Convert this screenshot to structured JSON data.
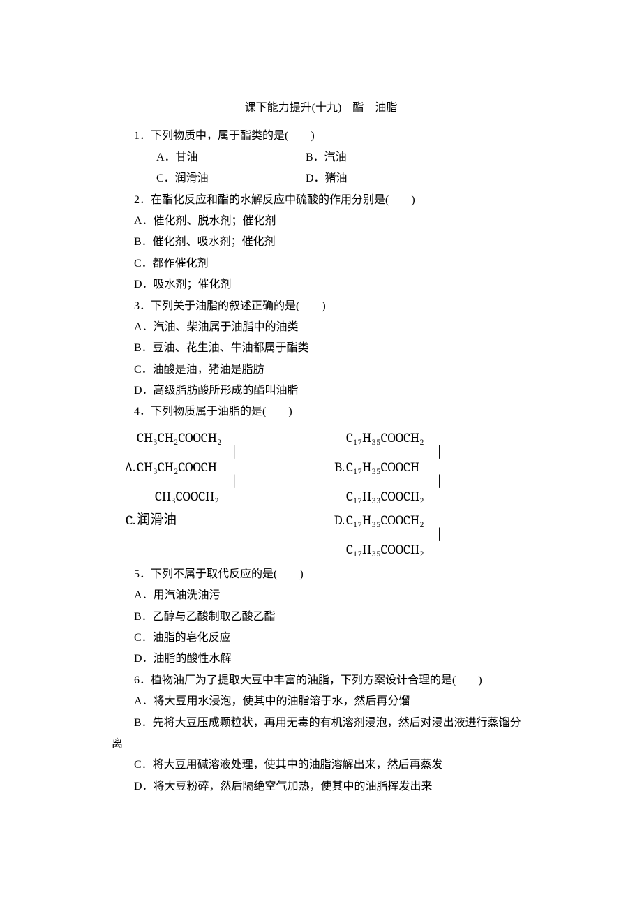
{
  "title": "课下能力提升(十九)　酯　油脂",
  "q1": {
    "stem": "1．下列物质中，属于酯类的是(　　)",
    "a": "A．甘油",
    "b": "B．汽油",
    "c": "C．润滑油",
    "d": "D．猪油"
  },
  "q2": {
    "stem": "2．在酯化反应和酯的水解反应中硫酸的作用分别是(　　)",
    "a": "A．催化剂、脱水剂；催化剂",
    "b": "B．催化剂、吸水剂；催化剂",
    "c": "C．都作催化剂",
    "d": "D．吸水剂；催化剂"
  },
  "q3": {
    "stem": "3．下列关于油脂的叙述正确的是(　　)",
    "a": "A．汽油、柴油属于油脂中的油类",
    "b": "B．豆油、花生油、牛油都属于酯类",
    "c": "C．油酸是油，猪油是脂肪",
    "d": "D．高级脂肪酸所形成的酯叫油脂"
  },
  "q4": {
    "stem": "4．下列物质属于油脂的是(　　)",
    "optA_prefix": "A.",
    "optA_l1": "CH₃CH₂COOCH₂",
    "optA_l2": "CH₃CH₂COOCH",
    "optA_l3": "CH₃COOCH₂",
    "optB_prefix": "B.",
    "optB_l1": "C₁₇H₃₅COOCH₂",
    "optB_l2": "C₁₇H₃₅COOCH",
    "optB_l3": "C₁₇H₃₃COOCH₂",
    "optC_prefix": "C.",
    "optC_text": "润滑油",
    "optD_prefix": "D.",
    "optD_l1": "C₁₇H₃₅COOCH₂",
    "optD_l2": "C₁₇H₃₅COOCH₂"
  },
  "q5": {
    "stem": "5．下列不属于取代反应的是(　　)",
    "a": "A．用汽油洗油污",
    "b": "B．乙醇与乙酸制取乙酸乙酯",
    "c": "C．油脂的皂化反应",
    "d": "D．油脂的酸性水解"
  },
  "q6": {
    "stem": "6．植物油厂为了提取大豆中丰富的油脂，下列方案设计合理的是(　　)",
    "a": "A．将大豆用水浸泡，使其中的油脂溶于水，然后再分馏",
    "b": "B．先将大豆压成颗粒状，再用无毒的有机溶剂浸泡，然后对浸出液进行蒸馏分离",
    "c": "C．将大豆用碱溶液处理，使其中的油脂溶解出来，然后再蒸发",
    "d": "D．将大豆粉碎，然后隔绝空气加热，使其中的油脂挥发出来"
  }
}
